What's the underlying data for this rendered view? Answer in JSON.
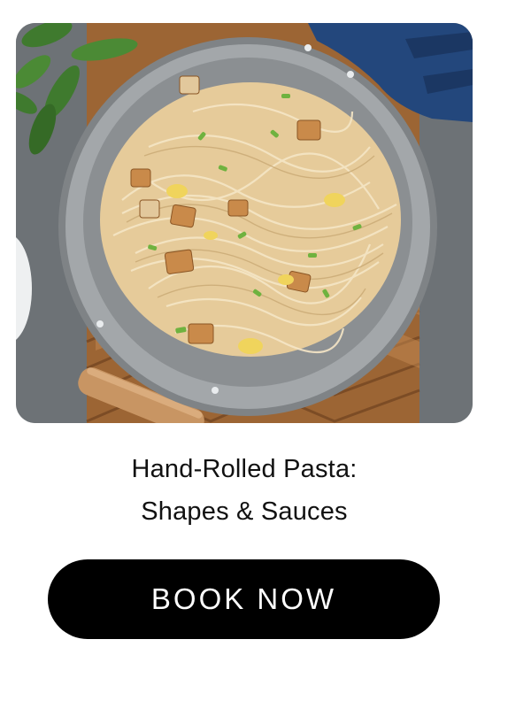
{
  "card": {
    "image_alt": "Stir-fried noodles with tofu, scrambled egg and green onions in a steel wok",
    "title_line1": "Hand-Rolled Pasta:",
    "title_line2": "Shapes & Sauces",
    "cta_label": "BOOK NOW"
  },
  "colors": {
    "button_bg": "#000000",
    "button_text": "#ffffff",
    "title_text": "#111111",
    "countertop": "#6b7074",
    "cutting_board": "#a0683a",
    "wok_steel": "#8f9396",
    "noodles": "#e9d2a6",
    "basil": "#3f7a2e",
    "towel": "#2a4f86"
  }
}
